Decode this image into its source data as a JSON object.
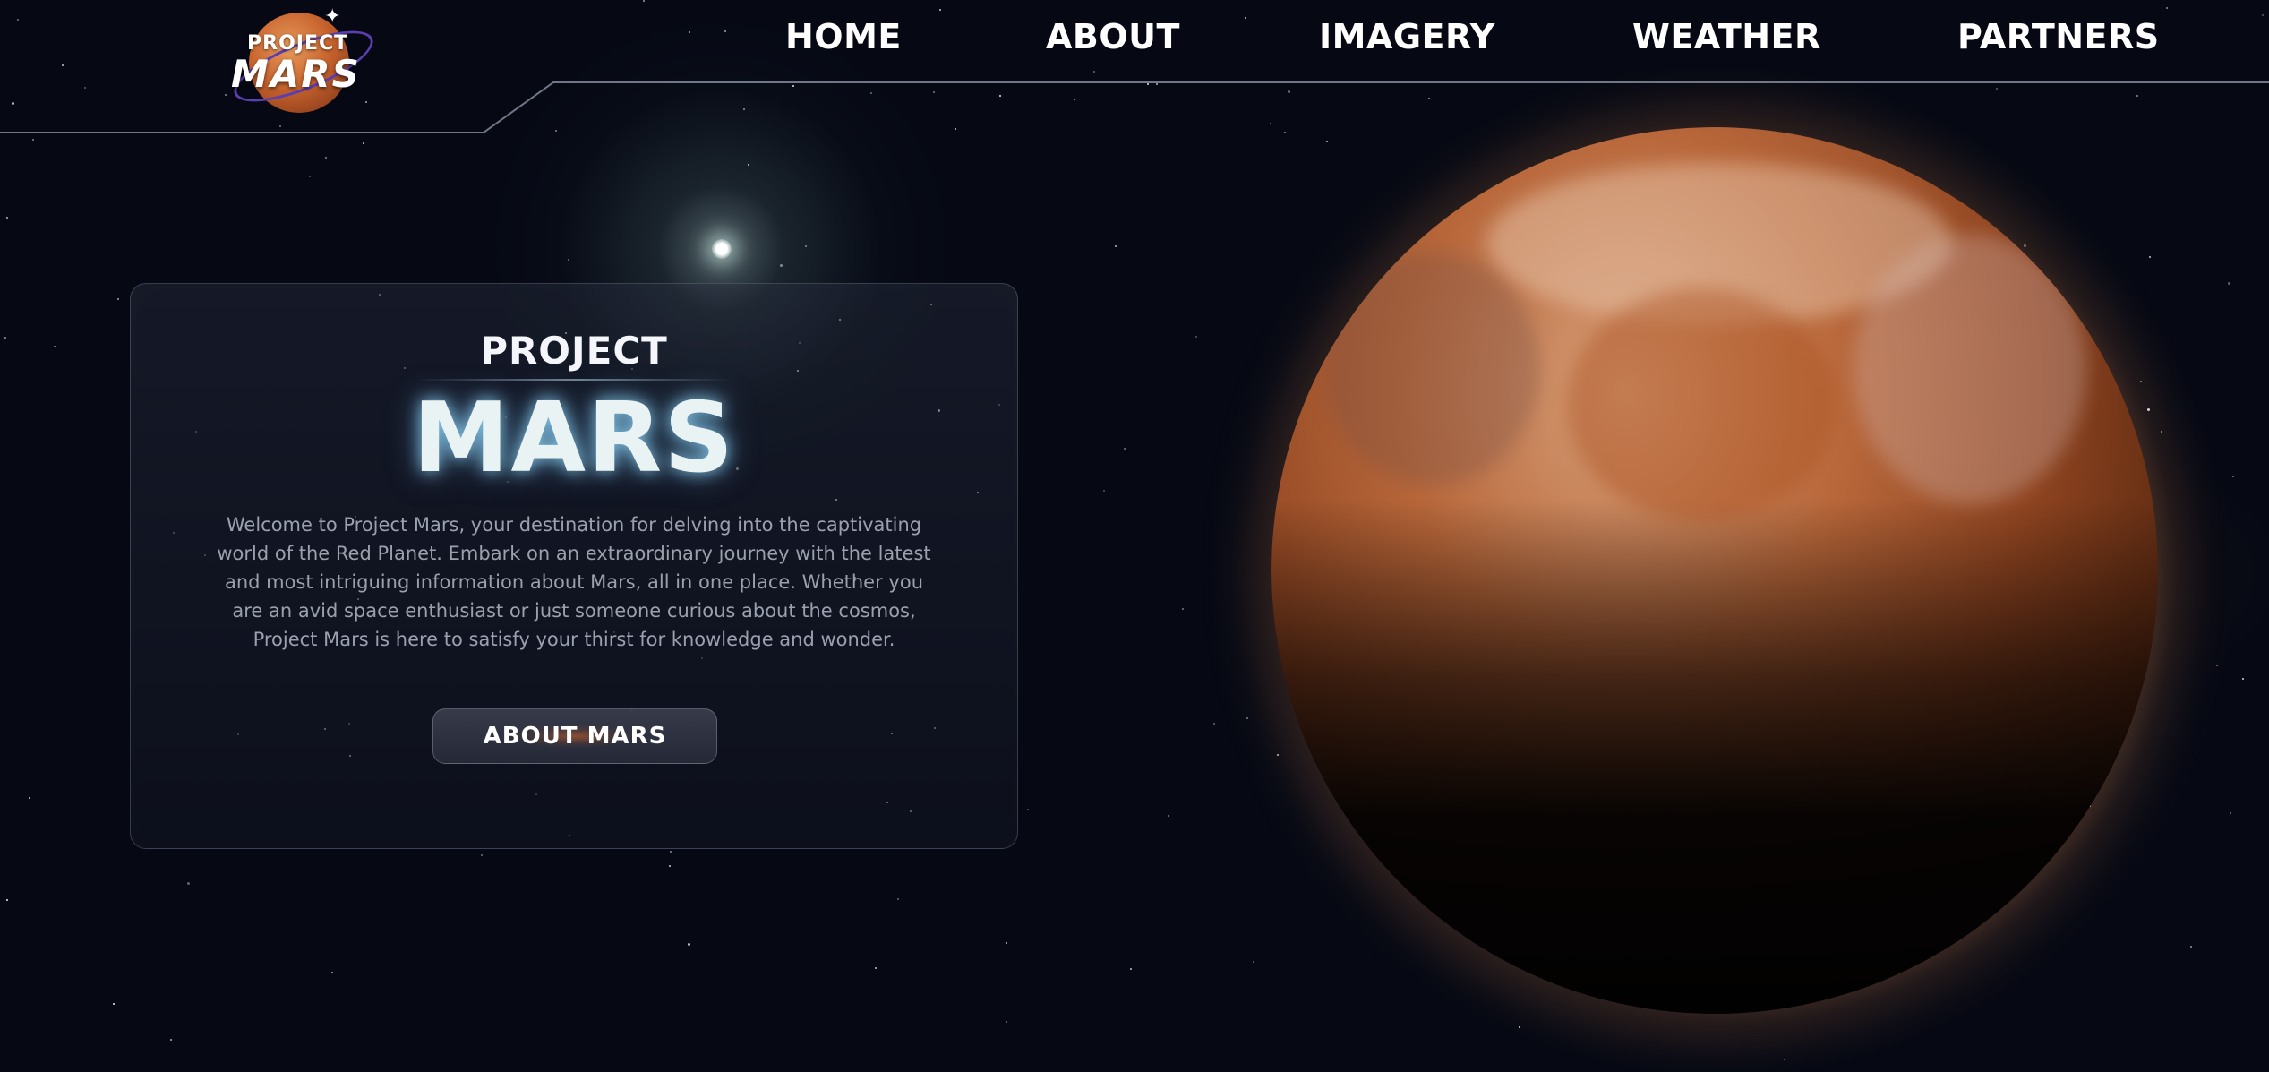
{
  "logo": {
    "line1": "PROJECT",
    "line2": "MARS"
  },
  "nav": {
    "items": [
      {
        "label": "HOME"
      },
      {
        "label": "ABOUT"
      },
      {
        "label": "IMAGERY"
      },
      {
        "label": "WEATHER"
      },
      {
        "label": "PARTNERS"
      }
    ]
  },
  "hero": {
    "title_top": "PROJECT",
    "title_main": "MARS",
    "description": "Welcome to Project Mars, your destination for delving into the captivating world of the Red Planet. Embark on an extraordinary journey with the latest and most intriguing information about Mars, all in one place. Whether you are an avid space enthusiast or just someone curious about the cosmos, Project Mars is here to satisfy your thirst for knowledge and wonder.",
    "button_label": "ABOUT MARS"
  },
  "colors": {
    "background": "#060914",
    "accent_mars": "#c8642e",
    "text_primary": "#ffffff",
    "text_muted": "#9aa0ad",
    "glow": "#8fd6ff"
  },
  "icons": {
    "logo": "mars-planet-logo",
    "sparkle": "sparkle-icon"
  }
}
